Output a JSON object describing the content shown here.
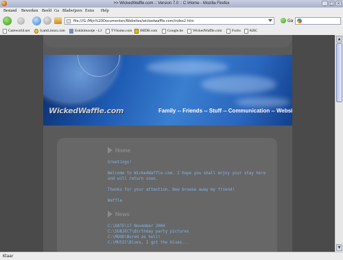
{
  "window": {
    "title": ">> WickedWaffle.com :: Version 7.0 :: C:\\Home - Mozilla Firefox",
    "buttons": [
      "_",
      "□",
      "×"
    ]
  },
  "menu": [
    "Bestand",
    "Bewerken",
    "Beeld",
    "Ga",
    "Bladwijzers",
    "Extra",
    "Help"
  ],
  "nav": {
    "url": "file:///G:/Mijn%20Documenten/Websites/wickedwaffle.com/index2.htm",
    "go_label": "Ga",
    "search_value": ""
  },
  "bookmarks": [
    "Gateworld.net",
    "IyamLimon.com",
    "Eskikimootje - LJ",
    "TVhome.com",
    "IMDB.com",
    "Google.be",
    "WickedWaffle.com",
    "Fortis",
    "KBC"
  ],
  "banner": {
    "brand": "WickedWaffle.com",
    "tagline": "Family -- Friends -- Stuff -- Communication -- Website"
  },
  "home": {
    "heading": "Home",
    "greeting": "Greetings!",
    "welcome": "Welcome to WickedWaffle.com. I hope you shall enjoy your stay here",
    "welcome2": "and will return soon.",
    "thanks": "Thanks for your attention. Now browse away my friend!",
    "signoff": "Waffle"
  },
  "news": {
    "heading": "News",
    "lines": [
      "C:\\DATE\\17 November 2004",
      "C:\\SUBJECT\\Birthday party pictures",
      "C:\\MOOD\\Bored as hell!",
      "C:\\MUSIC\\Blues, I got the blues..."
    ]
  },
  "status": "Klaar",
  "colors": {
    "accent_text": "#7fb6ec",
    "page_bg": "#4a4a4a"
  }
}
